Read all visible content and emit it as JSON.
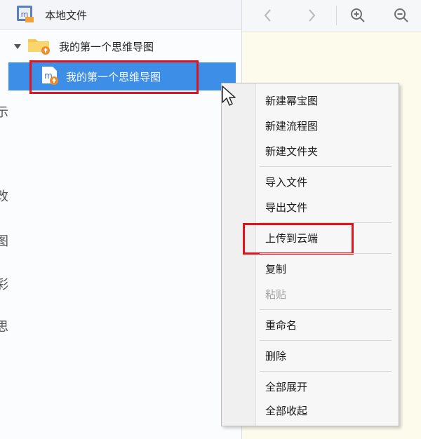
{
  "tree": {
    "root_label": "本地文件",
    "folder_label": "我的第一个思维导图",
    "file_label": "我的第一个思维导图"
  },
  "left_edge_glyphs": [
    "示",
    "改",
    "图",
    "彩",
    "思"
  ],
  "toolbar": {
    "back_icon": "chevron-left-icon",
    "forward_icon": "chevron-right-icon",
    "zoom_in_icon": "zoom-in-icon",
    "zoom_out_icon": "zoom-out-icon"
  },
  "context_menu": {
    "items": [
      {
        "label": "新建幂宝图",
        "enabled": true
      },
      {
        "label": "新建流程图",
        "enabled": true
      },
      {
        "label": "新建文件夹",
        "enabled": true
      },
      {
        "label": "导入文件",
        "enabled": true
      },
      {
        "label": "导出文件",
        "enabled": true
      },
      {
        "label": "上传到云端",
        "enabled": true,
        "highlighted": true
      },
      {
        "label": "复制",
        "enabled": true
      },
      {
        "label": "粘贴",
        "enabled": false
      },
      {
        "label": "重命名",
        "enabled": true
      },
      {
        "label": "删除",
        "enabled": true
      },
      {
        "label": "全部展开",
        "enabled": true
      },
      {
        "label": "全部收起",
        "enabled": true
      }
    ]
  },
  "colors": {
    "selection": "#3d8ee6",
    "highlight_border": "#e0141e",
    "canvas_bg": "#fdfbec"
  }
}
